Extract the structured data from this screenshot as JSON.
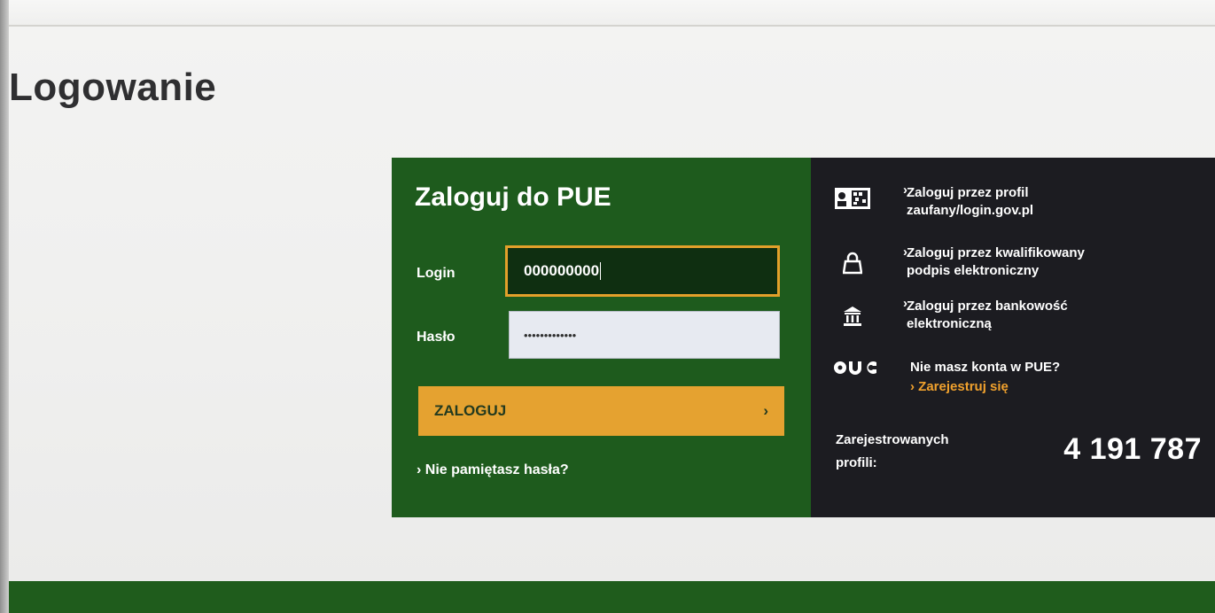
{
  "page": {
    "title": "Logowanie"
  },
  "login": {
    "title": "Zaloguj do PUE",
    "login_label": "Login",
    "login_value": "000000000",
    "password_label": "Hasło",
    "password_mask": "•••••••••••••",
    "submit_label": "ZALOGUJ",
    "forgot_label": "Nie pamiętasz hasła?"
  },
  "alternatives": {
    "items": [
      {
        "icon": "profile-card-icon",
        "label_line1": "Zaloguj przez profil",
        "label_line2": "zaufany/login.gov.pl"
      },
      {
        "icon": "lock-icon",
        "label_line1": "Zaloguj przez kwalifikowany",
        "label_line2": "podpis elektroniczny"
      },
      {
        "icon": "bank-icon",
        "label_line1": "Zaloguj przez bankowość",
        "label_line2": "elektroniczną"
      }
    ],
    "register_prompt": "Nie masz konta w PUE?",
    "register_link": "Zarejestruj się",
    "logo_icon": "pue-logo-icon",
    "stats_label_line1": "Zarejestrowanych",
    "stats_label_line2": "profili:",
    "stats_value": "4 191 787"
  },
  "colors": {
    "login_panel": "#1e5b1d",
    "alt_panel": "#1c1c21",
    "accent": "#e5a230",
    "footer": "#1f5c1c"
  }
}
